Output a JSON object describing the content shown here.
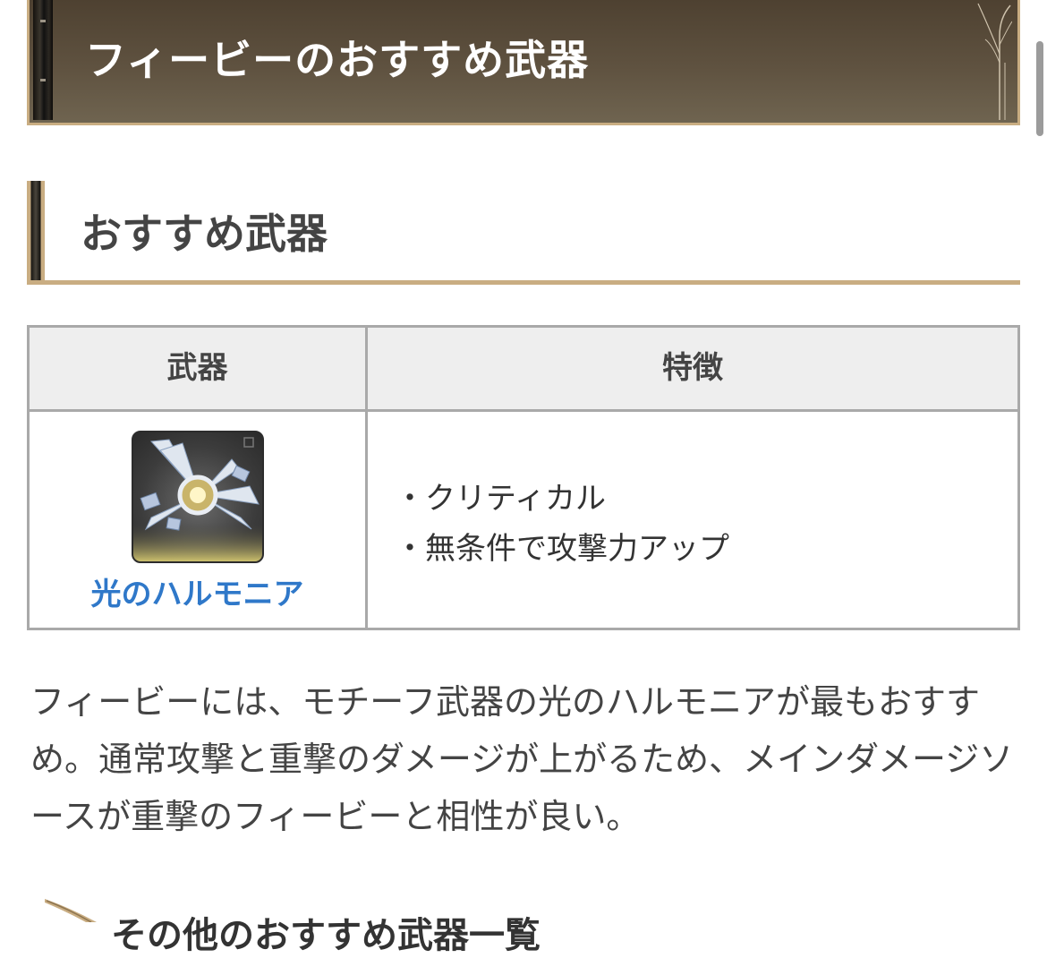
{
  "h2": {
    "title": "フィービーのおすすめ武器"
  },
  "h3": {
    "title": "おすすめ武器"
  },
  "table": {
    "headers": [
      "武器",
      "特徴"
    ],
    "rows": [
      {
        "weapon": "光のハルモニア",
        "features": [
          "・クリティカル",
          "・無条件で攻撃力アップ"
        ]
      }
    ]
  },
  "paragraph": "フィービーには、モチーフ武器の光のハルモニアが最もおすすめ。通常攻撃と重撃のダメージが上がるため、メインダメージソースが重撃のフィービーと相性が良い。",
  "h4": {
    "title": "その他のおすすめ武器一覧"
  },
  "colors": {
    "accent_gold": "#c9ad82",
    "banner_brown": "#5a4d3b",
    "link_blue": "#2f78c9",
    "header_gray": "#eeeeee"
  }
}
